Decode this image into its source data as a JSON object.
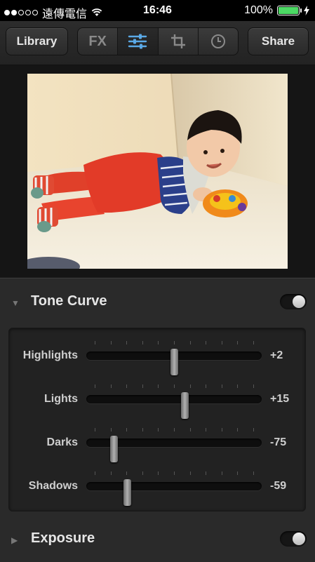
{
  "status_bar": {
    "carrier": "遠傳電信",
    "time": "16:46",
    "battery": "100%",
    "signal_bars_filled": 2,
    "signal_bars_total": 5,
    "wifi_icon": "wifi-icon",
    "charging_icon": "bolt-icon"
  },
  "toolbar": {
    "library_label": "Library",
    "share_label": "Share",
    "tabs": [
      {
        "label": "FX",
        "icon": "fx-text"
      },
      {
        "label": "",
        "icon": "sliders-icon",
        "active": true
      },
      {
        "label": "",
        "icon": "crop-icon"
      },
      {
        "label": "",
        "icon": "clock-icon"
      }
    ],
    "active_color": "#5aa9e6"
  },
  "photo": {
    "description_icon": "photo"
  },
  "tone_curve": {
    "title": "Tone Curve",
    "enabled": true,
    "sliders": [
      {
        "label": "Highlights",
        "value": "+2",
        "position": 0.5
      },
      {
        "label": "Lights",
        "value": "+15",
        "position": 0.56
      },
      {
        "label": "Darks",
        "value": "-75",
        "position": 0.155
      },
      {
        "label": "Shadows",
        "value": "-59",
        "position": 0.23
      }
    ]
  },
  "exposure": {
    "title": "Exposure",
    "enabled": true
  }
}
